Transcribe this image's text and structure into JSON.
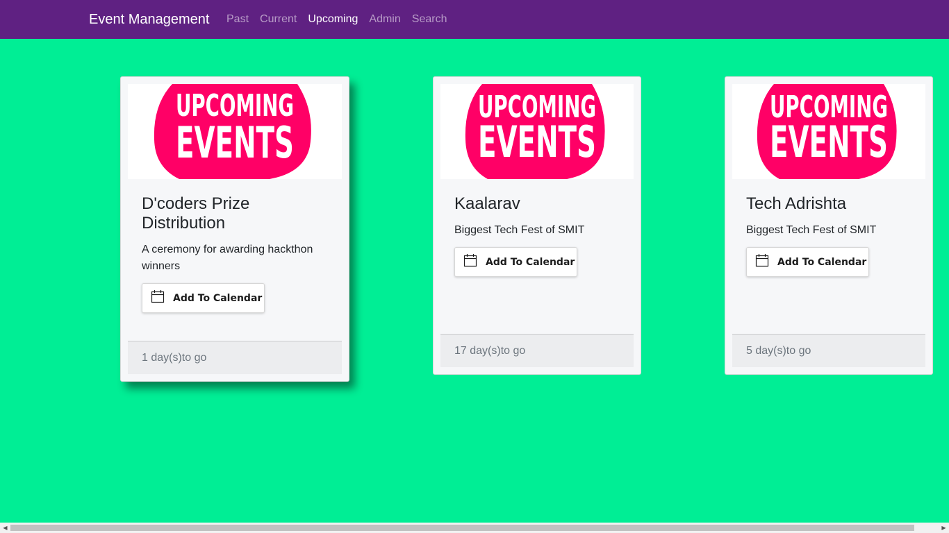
{
  "navbar": {
    "brand": "Event Management",
    "links": [
      {
        "label": "Past",
        "active": false
      },
      {
        "label": "Current",
        "active": false
      },
      {
        "label": "Upcoming",
        "active": true
      },
      {
        "label": "Admin",
        "active": false
      },
      {
        "label": "Search",
        "active": false
      }
    ]
  },
  "banner": {
    "line1": "UPCOMING",
    "line2": "EVENTS",
    "color": "#ff0066"
  },
  "events": [
    {
      "title": "D'coders Prize Distribution",
      "description": "A ceremony for awarding hackthon winners",
      "button_label": "Add To Calendar",
      "countdown": "1 day(s)to go"
    },
    {
      "title": "Kaalarav",
      "description": "Biggest Tech Fest of SMIT",
      "button_label": "Add To Calendar",
      "countdown": "17 day(s)to go"
    },
    {
      "title": "Tech Adrishta",
      "description": "Biggest Tech Fest of SMIT",
      "button_label": "Add To Calendar",
      "countdown": "5 day(s)to go"
    }
  ],
  "colors": {
    "navbar": "#5f2182",
    "background": "#00ee95",
    "card": "#f6f7f9"
  }
}
